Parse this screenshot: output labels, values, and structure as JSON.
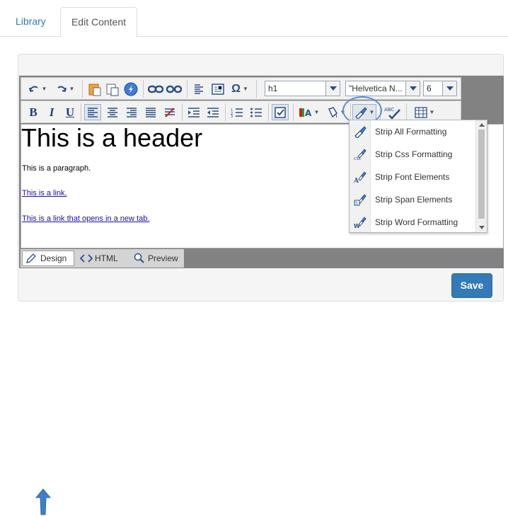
{
  "tabs": [
    {
      "label": "Library"
    },
    {
      "label": "Edit Content"
    }
  ],
  "toolbar": {
    "format_value": "h1",
    "font_value": "\"Helvetica N...",
    "size_value": "6",
    "icons": [
      "undo-icon",
      "redo-icon",
      "paste-icon",
      "paste-text-icon",
      "flash-icon",
      "link-icon",
      "unlink-icon",
      "paragraph-icon",
      "template-icon",
      "omega-icon",
      "bold-icon",
      "italic-icon",
      "underline-icon",
      "align-left-icon",
      "align-center-icon",
      "align-right-icon",
      "justify-icon",
      "strikethrough-icon",
      "indent-icon",
      "outdent-icon",
      "ordered-list-icon",
      "unordered-list-icon",
      "format-icon",
      "font-color-icon",
      "highlight-icon",
      "strip-formatting-icon",
      "spellcheck-icon",
      "table-icon"
    ],
    "bold_label": "B",
    "italic_label": "I",
    "underline_label": "U",
    "omega_label": "Ω",
    "spell_label": "ABC"
  },
  "content": {
    "header": "This is a header",
    "paragraph": "This is a paragraph.",
    "link1": "This is a link.",
    "link2": "This is a link that opens in a new tab."
  },
  "modes": {
    "design": "Design",
    "html": "HTML",
    "preview": "Preview"
  },
  "dropdown": {
    "items": [
      {
        "label": "Strip All Formatting",
        "icon": "strip-all-icon"
      },
      {
        "label": "Strip Css Formatting",
        "icon": "strip-css-icon"
      },
      {
        "label": "Strip Font Elements",
        "icon": "strip-font-icon"
      },
      {
        "label": "Strip Span Elements",
        "icon": "strip-span-icon"
      },
      {
        "label": "Strip Word Formatting",
        "icon": "strip-word-icon"
      }
    ]
  },
  "footer": {
    "save_label": "Save"
  },
  "colors": {
    "accent": "#337ab7",
    "editor_bg": "#828282",
    "link": "#1a0dab",
    "annotation": "#5b8dd6"
  }
}
